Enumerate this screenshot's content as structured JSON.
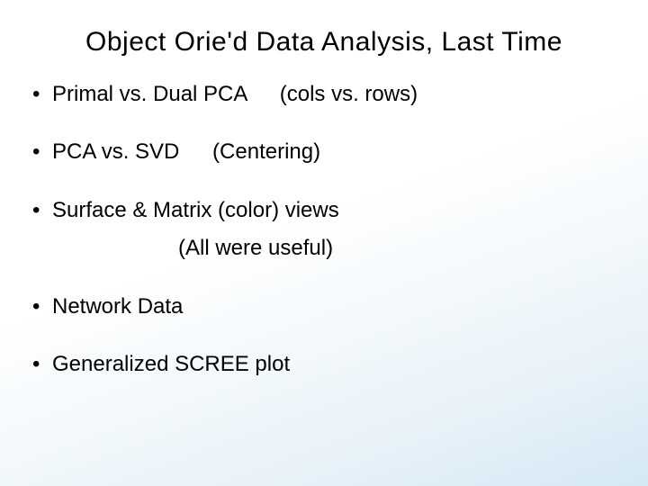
{
  "title": "Object Orie'd Data Analysis, Last Time",
  "bullets": {
    "b1_main": "Primal vs. Dual PCA",
    "b1_note": "(cols vs. rows)",
    "b2_main": "PCA vs. SVD",
    "b2_note": "(Centering)",
    "b3_main": "Surface & Matrix (color)  views",
    "b3_sub": "(All were useful)",
    "b4_main": "Network Data",
    "b5_main": "Generalized SCREE plot"
  }
}
